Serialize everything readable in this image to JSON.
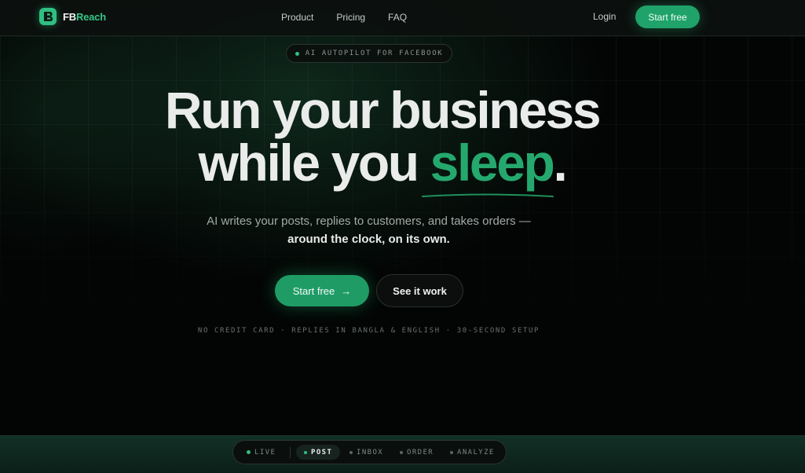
{
  "nav": {
    "brand_fb": "FB",
    "brand_rest": "Reach",
    "links": [
      "Product",
      "Pricing",
      "FAQ"
    ],
    "login": "Login",
    "start_free": "Start free"
  },
  "badge": {
    "text": "AI AUTOPILOT FOR FACEBOOK"
  },
  "hero": {
    "line1": "Run your business",
    "line2_prefix": "while you ",
    "line2_accent": "sleep",
    "line2_suffix": ".",
    "subtitle_1": "AI writes your posts, replies to customers, and takes orders —",
    "subtitle_2": "around the clock, on its own."
  },
  "cta": {
    "primary": "Start free",
    "primary_arrow": "→",
    "secondary": "See it work"
  },
  "assurance": "NO CREDIT CARD · REPLIES IN BANGLA & ENGLISH · 30-SECOND SETUP",
  "tabs": {
    "live": "LIVE",
    "post": "POST",
    "inbox": "INBOX",
    "order": "ORDER",
    "analyze": "ANALYZE",
    "active": "POST"
  },
  "colors": {
    "accent": "#25a86e",
    "button": "#1fa36a",
    "background": "#030504"
  },
  "icons": {
    "logo": "fbreach-logo-icon",
    "arrow": "arrow-right-icon"
  }
}
